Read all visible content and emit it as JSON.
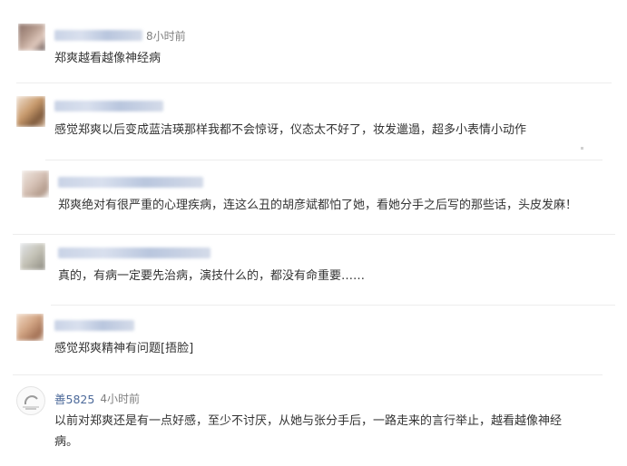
{
  "comments": [
    {
      "user": "",
      "time": "8小时前",
      "text": "郑爽越看越像神经病"
    },
    {
      "user": "",
      "time": "",
      "text": "感觉郑爽以后变成蓝洁瑛那样我都不会惊讶，仪态太不好了，妆发邋遢，超多小表情小动作"
    },
    {
      "user": "",
      "time": "",
      "text": "郑爽绝对有很严重的心理疾病，连这么丑的胡彦斌都怕了她，看她分手之后写的那些话，头皮发麻！"
    },
    {
      "user": "",
      "time": "",
      "text": "真的，有病一定要先治病，演技什么的，都没有命重要……"
    },
    {
      "user": "",
      "time": "",
      "text": "感觉郑爽精神有问题[捂脸]"
    },
    {
      "user": "善5825",
      "time": "4小时前",
      "text": "以前对郑爽还是有一点好感，至少不讨厌，从她与张分手后，一路走来的言行举止，越看越像神经",
      "text_line2": "病。"
    }
  ],
  "colors": {
    "username": "#4d6a9a",
    "time": "#808080",
    "text": "#333333",
    "divider": "#ededed"
  },
  "icons": {
    "avatar": "avatar-icon"
  }
}
